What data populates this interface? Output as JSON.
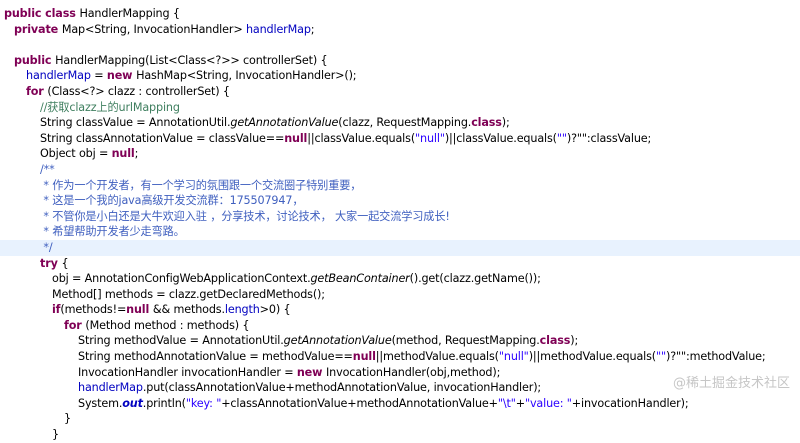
{
  "editor": {
    "lines": [
      {
        "indent": 0,
        "tokens": [
          [
            "kw",
            "public class "
          ],
          [
            "",
            "HandlerMapping {"
          ]
        ]
      },
      {
        "indent": 1,
        "tokens": [
          [
            "kw",
            "private "
          ],
          [
            "",
            "Map<String, InvocationHandler> "
          ],
          [
            "fld",
            "handlerMap"
          ],
          [
            "",
            ";"
          ]
        ]
      },
      {
        "indent": 0,
        "tokens": []
      },
      {
        "indent": 1,
        "tokens": [
          [
            "kw",
            "public "
          ],
          [
            "",
            "HandlerMapping(List<Class<?>> controllerSet) {"
          ]
        ]
      },
      {
        "indent": 2,
        "tokens": [
          [
            "fld",
            "handlerMap"
          ],
          [
            "",
            " = "
          ],
          [
            "kw",
            "new "
          ],
          [
            "",
            "HashMap<String, InvocationHandler>();"
          ]
        ]
      },
      {
        "indent": 2,
        "tokens": [
          [
            "kw",
            "for "
          ],
          [
            "",
            "(Class<?> clazz : controllerSet) {"
          ]
        ]
      },
      {
        "indent": 3,
        "tokens": [
          [
            "cmt",
            "//获取clazz上的urlMapping"
          ]
        ]
      },
      {
        "indent": 3,
        "tokens": [
          [
            "",
            "String classValue = AnnotationUtil."
          ],
          [
            "mth",
            "getAnnotationValue"
          ],
          [
            "",
            "(clazz, RequestMapping."
          ],
          [
            "kw",
            "class"
          ],
          [
            "",
            "); "
          ]
        ]
      },
      {
        "indent": 3,
        "tokens": [
          [
            "",
            "String classAnnotationValue = classValue=="
          ],
          [
            "kw",
            "null"
          ],
          [
            "",
            "||classValue.equals("
          ],
          [
            "str",
            "\"null\""
          ],
          [
            "",
            ")||classValue.equals("
          ],
          [
            "str",
            "\"\""
          ],
          [
            "",
            ")?\"\":classValue;"
          ]
        ]
      },
      {
        "indent": 3,
        "tokens": [
          [
            "",
            "Object obj = "
          ],
          [
            "kw",
            "null"
          ],
          [
            "",
            ";"
          ]
        ]
      },
      {
        "indent": 3,
        "tokens": [
          [
            "doc",
            "/**"
          ]
        ]
      },
      {
        "indent": 3,
        "tokens": [
          [
            "doc",
            " * 作为一个开发者，有一个学习的氛围跟一个交流圈子特别重要，"
          ]
        ]
      },
      {
        "indent": 3,
        "tokens": [
          [
            "doc",
            " * 这是一个我的java高级开发交流群：175507947，"
          ]
        ]
      },
      {
        "indent": 3,
        "tokens": [
          [
            "doc",
            " * 不管你是小白还是大牛欢迎入驻 ，分享技术，讨论技术， 大家一起交流学习成长!"
          ]
        ]
      },
      {
        "indent": 3,
        "tokens": [
          [
            "doc",
            " * 希望帮助开发者少走弯路。"
          ]
        ]
      },
      {
        "indent": 3,
        "highlight": true,
        "tokens": [
          [
            "doc",
            " */"
          ]
        ]
      },
      {
        "indent": 3,
        "tokens": [
          [
            "kw",
            "try "
          ],
          [
            "",
            "{"
          ]
        ]
      },
      {
        "indent": 4,
        "tokens": [
          [
            "",
            "obj = AnnotationConfigWebApplicationContext."
          ],
          [
            "mth",
            "getBeanContainer"
          ],
          [
            "",
            "().get(clazz.getName());"
          ]
        ]
      },
      {
        "indent": 4,
        "tokens": [
          [
            "",
            "Method[] methods = clazz.getDeclaredMethods();"
          ]
        ]
      },
      {
        "indent": 4,
        "tokens": [
          [
            "kw",
            "if"
          ],
          [
            "",
            "(methods!="
          ],
          [
            "kw",
            "null "
          ],
          [
            "",
            "&& methods."
          ],
          [
            "fld",
            "length"
          ],
          [
            "",
            ">0) {"
          ]
        ]
      },
      {
        "indent": 5,
        "tokens": [
          [
            "kw",
            "for "
          ],
          [
            "",
            "(Method method : methods) {"
          ]
        ]
      },
      {
        "indent": 6,
        "tokens": [
          [
            "",
            "String methodValue = AnnotationUtil."
          ],
          [
            "mth",
            "getAnnotationValue"
          ],
          [
            "",
            "(method, RequestMapping."
          ],
          [
            "kw",
            "class"
          ],
          [
            "",
            ");"
          ]
        ]
      },
      {
        "indent": 6,
        "tokens": [
          [
            "",
            "String methodAnnotationValue = methodValue=="
          ],
          [
            "kw",
            "null"
          ],
          [
            "",
            "||methodValue.equals("
          ],
          [
            "str",
            "\"null\""
          ],
          [
            "",
            ")||methodValue.equals("
          ],
          [
            "str",
            "\"\""
          ],
          [
            "",
            ")?\"\":methodValue;"
          ]
        ]
      },
      {
        "indent": 6,
        "tokens": [
          [
            "",
            "InvocationHandler invocationHandler = "
          ],
          [
            "kw",
            "new "
          ],
          [
            "",
            "InvocationHandler(obj,method);"
          ]
        ]
      },
      {
        "indent": 6,
        "tokens": [
          [
            "fld",
            "handlerMap"
          ],
          [
            "",
            ".put(classAnnotationValue+methodAnnotationValue, invocationHandler);"
          ]
        ]
      },
      {
        "indent": 6,
        "tokens": [
          [
            "",
            "System."
          ],
          [
            "sfl",
            "out"
          ],
          [
            "",
            ".println("
          ],
          [
            "str",
            "\"key: \""
          ],
          [
            "",
            "+classAnnotationValue+methodAnnotationValue+"
          ],
          [
            "str",
            "\"\\t\""
          ],
          [
            "",
            "+"
          ],
          [
            "str",
            "\"value: \""
          ],
          [
            "",
            "+invocationHandler);"
          ]
        ]
      },
      {
        "indent": 5,
        "tokens": [
          [
            "",
            "}"
          ]
        ]
      },
      {
        "indent": 4,
        "tokens": [
          [
            "",
            "}"
          ]
        ]
      }
    ]
  },
  "watermark": "@稀土掘金技术社区"
}
